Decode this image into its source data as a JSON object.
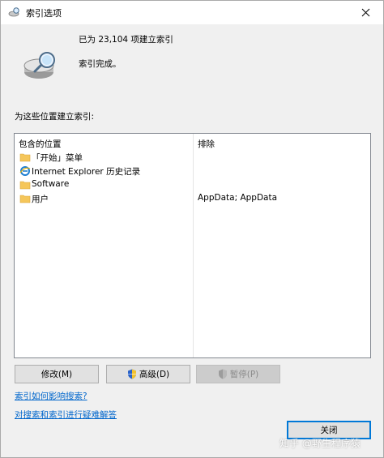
{
  "window": {
    "title": "索引选项"
  },
  "status": {
    "count_text": "已为 23,104 项建立索引",
    "done_text": "索引完成。"
  },
  "locations": {
    "section_label": "为这些位置建立索引:",
    "col_included": "包含的位置",
    "col_excluded": "排除",
    "rows": [
      {
        "name": "「开始」菜单",
        "exclude": "",
        "icon": "folder-icon"
      },
      {
        "name": "Internet Explorer 历史记录",
        "exclude": "",
        "icon": "internet-explorer-icon"
      },
      {
        "name": "Software",
        "exclude": "",
        "icon": "folder-icon"
      },
      {
        "name": "用户",
        "exclude": "AppData; AppData",
        "icon": "folder-icon"
      }
    ]
  },
  "buttons": {
    "modify": "修改(M)",
    "advanced": "高级(D)",
    "pause": "暂停(P)",
    "close": "关闭"
  },
  "links": {
    "how_affects": "索引如何影响搜索?",
    "troubleshoot": "对搜索和索引进行疑难解答"
  },
  "watermark": "知乎 @野生程序猿"
}
